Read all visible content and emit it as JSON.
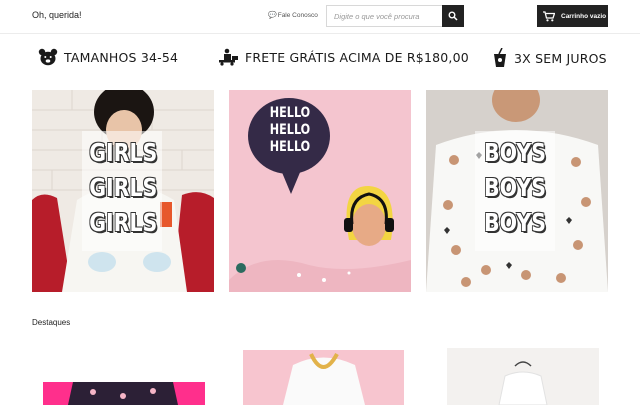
{
  "header": {
    "greeting": "Oh, querida!",
    "contact_label": "Fale Conosco",
    "search_placeholder": "Digite o que você procura",
    "cart_label": "Carrinho vazio"
  },
  "infobar": {
    "items": [
      {
        "label": "TAMANHOS 34-54",
        "icon": "bear-icon"
      },
      {
        "label": "FRETE GRÁTIS ACIMA DE R$180,00",
        "icon": "delivery-icon"
      },
      {
        "label": "3X SEM JUROS",
        "icon": "drink-icon"
      }
    ]
  },
  "banners": [
    {
      "lines": [
        "GIRLS",
        "GIRLS",
        "GIRLS"
      ]
    },
    {
      "bubble": [
        "HELLO",
        "HELLO",
        "HELLO"
      ]
    },
    {
      "lines": [
        "BOYS",
        "BOYS",
        "BOYS"
      ]
    }
  ],
  "section": {
    "title": "Destaques"
  },
  "colors": {
    "accent": "#222222",
    "pink": "#f5c6cf",
    "hot_pink": "#ff2f8c"
  }
}
